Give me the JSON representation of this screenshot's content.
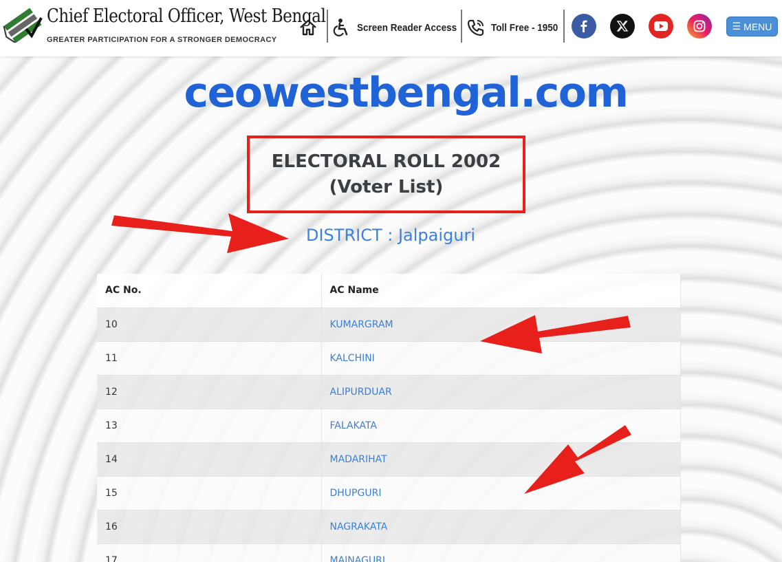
{
  "header": {
    "title": "Chief Electoral Officer, West Bengal",
    "tagline": "GREATER PARTICIPATION FOR A STRONGER DEMOCRACY",
    "screen_reader": "Screen Reader Access",
    "toll_free": "Toll Free - 1950",
    "menu_label": "MENU",
    "menu_glyph": "☰",
    "icons": [
      "home-icon",
      "accessibility-icon",
      "phone-icon",
      "facebook-icon",
      "x-icon",
      "youtube-icon",
      "instagram-icon"
    ],
    "colors": {
      "facebook": "#3b5ba5",
      "x": "#111111",
      "youtube": "#e22522",
      "instagram": "#d6249f",
      "menu": "#4a8fd8"
    }
  },
  "site_title": "ceowestbengal.com",
  "roll": {
    "line1": "ELECTORAL ROLL 2002",
    "line2": "(Voter List)"
  },
  "district": "DISTRICT : Jalpaiguri",
  "table": {
    "headers": [
      "AC No.",
      "AC Name"
    ],
    "rows": [
      {
        "no": "10",
        "name": "KUMARGRAM"
      },
      {
        "no": "11",
        "name": "KALCHINI"
      },
      {
        "no": "12",
        "name": "ALIPURDUAR"
      },
      {
        "no": "13",
        "name": "FALAKATA"
      },
      {
        "no": "14",
        "name": "MADARIHAT"
      },
      {
        "no": "15",
        "name": "DHUPGURI"
      },
      {
        "no": "16",
        "name": "NAGRAKATA"
      },
      {
        "no": "17",
        "name": "MAINAGURI"
      }
    ]
  },
  "colors": {
    "accent": "#1f63d6",
    "link": "#3b7fd4",
    "highlight_border": "#e8201c",
    "annotation_arrow": "#e8201c"
  }
}
